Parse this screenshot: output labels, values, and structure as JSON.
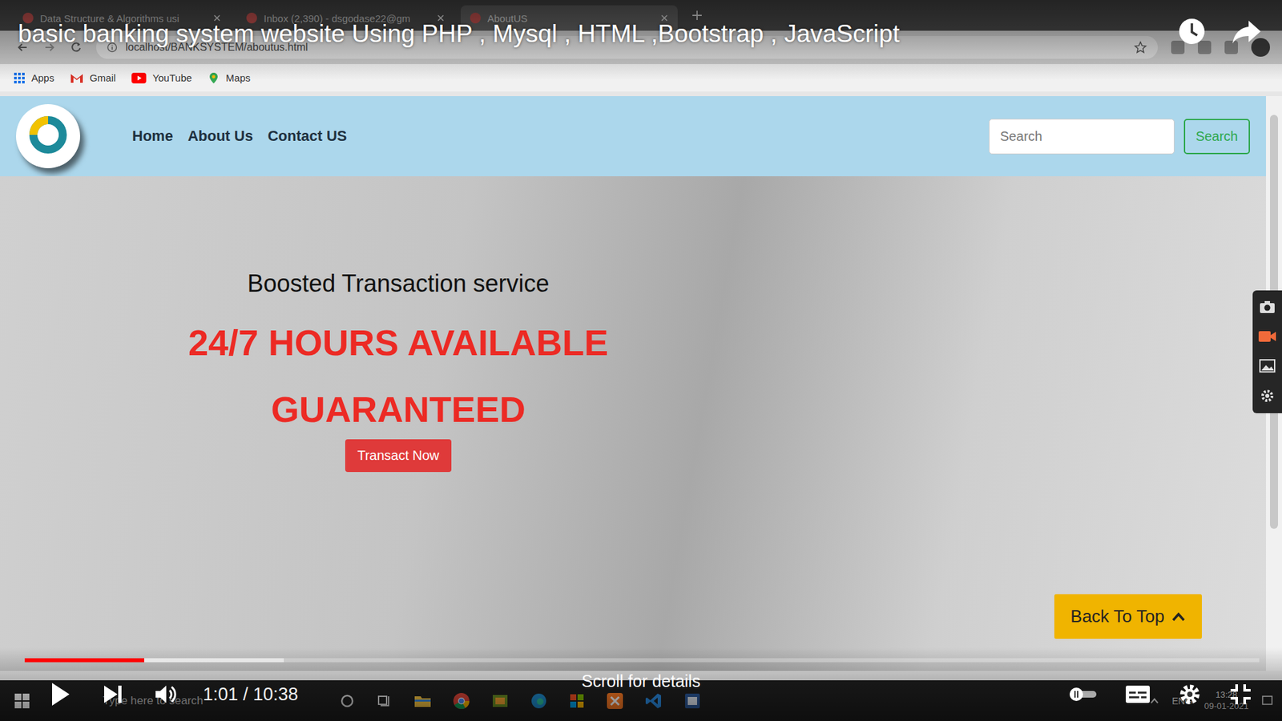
{
  "video": {
    "title": "basic banking system website Using PHP , Mysql , HTML ,Bootstrap , JavaScript",
    "time": "1:01 / 10:38",
    "hint": "Scroll for details",
    "paused": true,
    "played": 0.097,
    "buffered": 0.21
  },
  "browser": {
    "tabs": [
      {
        "label": "Data Structure & Algorithms usi",
        "selected": false
      },
      {
        "label": "Inbox (2,390) - dsgodase22@gm",
        "selected": false
      },
      {
        "label": "AboutUS",
        "selected": true
      }
    ],
    "url": "localhost/BANKSYSTEM/aboutus.html",
    "bookmarks": [
      "Apps",
      "Gmail",
      "YouTube",
      "Maps"
    ]
  },
  "site": {
    "nav": [
      "Home",
      "About Us",
      "Contact US"
    ],
    "search": {
      "placeholder": "Search",
      "button": "Search"
    },
    "hero": {
      "subtitle": "Boosted Transaction service",
      "headline": "24/7 HOURS AVAILABLE",
      "tagline": "GUARANTEED",
      "cta": "Transact Now"
    },
    "back_to_top": "Back To Top"
  },
  "taskbar": {
    "search_placeholder": "Type here to search",
    "language": "ENG",
    "time": "13:28",
    "date": "09-01-2021"
  }
}
